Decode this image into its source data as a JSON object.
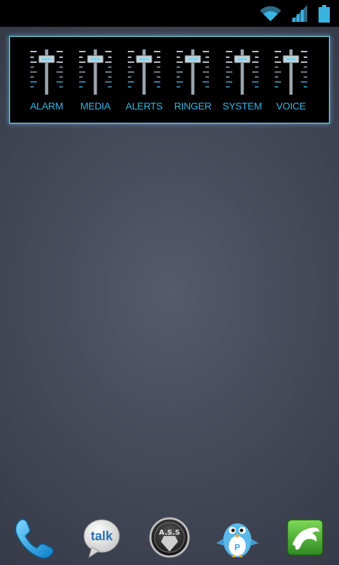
{
  "status_bar": {
    "icons": [
      "wifi-icon",
      "cell-signal-icon",
      "battery-icon"
    ]
  },
  "volume_widget": {
    "accent_color": "#39b4e0",
    "channels": [
      {
        "label": "ALARM",
        "icon": "slider-knob",
        "level": 0.85
      },
      {
        "label": "MEDIA",
        "icon": "slider-knob",
        "level": 0.85
      },
      {
        "label": "ALERTS",
        "icon": "slider-knob",
        "level": 0.85
      },
      {
        "label": "RINGER",
        "icon": "slider-knob",
        "level": 0.85
      },
      {
        "label": "SYSTEM",
        "icon": "slider-knob",
        "level": 0.85
      },
      {
        "label": "VOICE",
        "icon": "slider-knob",
        "level": 0.85
      }
    ]
  },
  "dock": {
    "apps": [
      {
        "name": "Phone",
        "icon": "phone-icon"
      },
      {
        "name": "Talk",
        "icon": "talk-icon",
        "text": "talk"
      },
      {
        "name": "Anti Social Social Club",
        "icon": "ass-badge-icon",
        "text": "A.S.S"
      },
      {
        "name": "Plume",
        "icon": "plume-bird-icon",
        "text": "P"
      },
      {
        "name": "Dolphin Browser",
        "icon": "dolphin-icon"
      }
    ]
  }
}
